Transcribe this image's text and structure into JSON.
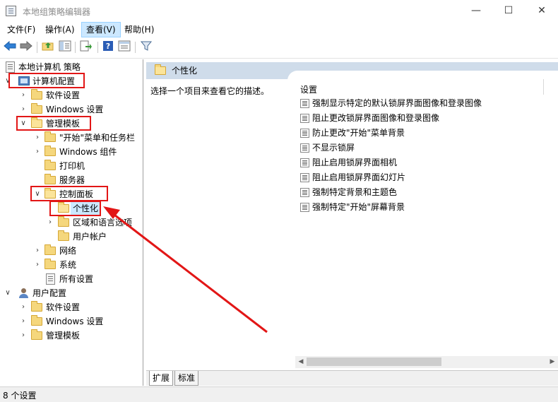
{
  "window": {
    "title": "本地组策略编辑器",
    "minimize": "—",
    "maximize": "☐",
    "close": "✕"
  },
  "menu": [
    "文件(F)",
    "操作(A)",
    "查看(V)",
    "帮助(H)"
  ],
  "toolbar": {
    "back": "back-arrow-icon",
    "forward": "forward-arrow-icon",
    "up": "up-folder-icon",
    "show_hide_tree": "show-tree-icon",
    "export": "export-list-icon",
    "help": "help-icon",
    "properties": "properties-icon",
    "filter": "filter-icon"
  },
  "tree": {
    "root": "本地计算机 策略",
    "computer_config": "计算机配置",
    "software_settings": "软件设置",
    "windows_settings": "Windows 设置",
    "admin_templates": "管理模板",
    "start_menu": "\"开始\"菜单和任务栏",
    "windows_components": "Windows 组件",
    "printers": "打印机",
    "server": "服务器",
    "control_panel": "控制面板",
    "personalization": "个性化",
    "region_language": "区域和语言选项",
    "user_accounts": "用户帐户",
    "network": "网络",
    "system": "系统",
    "all_settings": "所有设置",
    "user_config": "用户配置",
    "user_software_settings": "软件设置",
    "user_windows_settings": "Windows 设置",
    "user_admin_templates": "管理模板"
  },
  "right": {
    "header": "个性化",
    "description": "选择一个项目来查看它的描述。",
    "column": "设置",
    "settings": [
      "强制显示特定的默认锁屏界面图像和登录图像",
      "阻止更改锁屏界面图像和登录图像",
      "防止更改\"开始\"菜单背景",
      "不显示锁屏",
      "阻止启用锁屏界面相机",
      "阻止启用锁屏界面幻灯片",
      "强制特定背景和主题色",
      "强制特定\"开始\"屏幕背景"
    ],
    "tabs": [
      "扩展",
      "标准"
    ]
  },
  "status": "8 个设置",
  "colors": {
    "annotation": "#e21616",
    "header_band": "#cfdcea",
    "selection": "#cce8ff"
  }
}
